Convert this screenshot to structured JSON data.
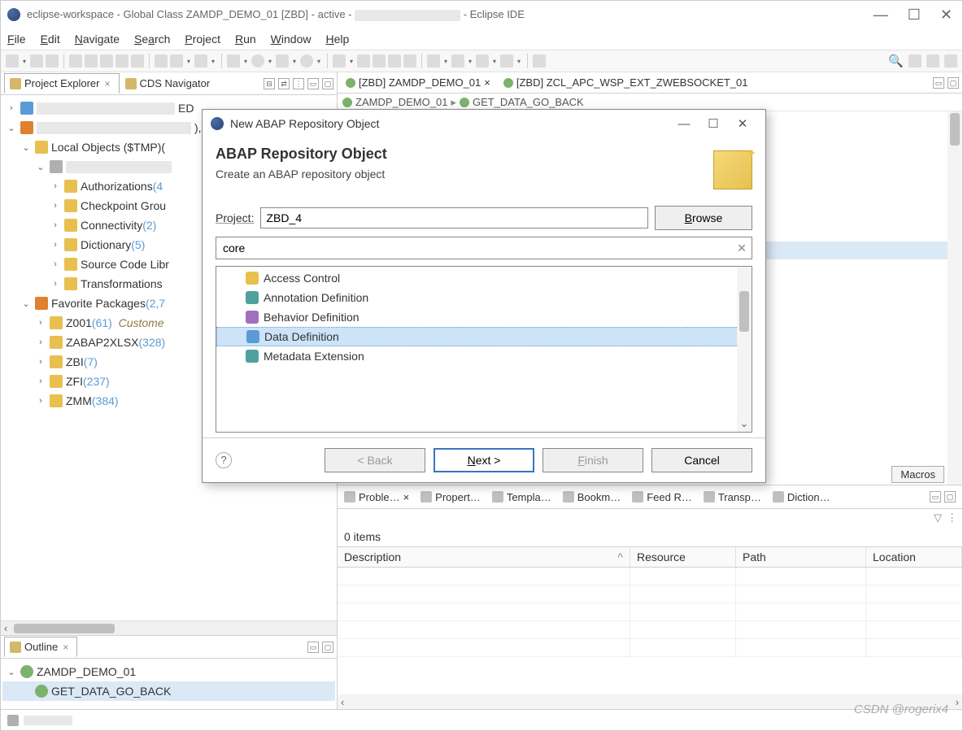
{
  "window": {
    "title_prefix": "eclipse-workspace - Global Class ZAMDP_DEMO_01 [ZBD]  - active - ",
    "title_suffix": " - Eclipse IDE"
  },
  "menubar": [
    "File",
    "Edit",
    "Navigate",
    "Search",
    "Project",
    "Run",
    "Window",
    "Help"
  ],
  "left": {
    "tabs": {
      "explorer": "Project Explorer",
      "cds": "CDS Navigator"
    },
    "tree": {
      "local": "Local Objects ($TMP)",
      "auth": "Authorizations",
      "auth_cnt": "(4",
      "chk": "Checkpoint Grou",
      "conn": "Connectivity",
      "conn_cnt": "(2)",
      "dict": "Dictionary",
      "dict_cnt": "(5)",
      "src": "Source Code Libr",
      "trans": "Transformations",
      "fav": "Favorite Packages",
      "fav_cnt": "(2,7",
      "z001": "Z001",
      "z001_cnt": "(61)",
      "z001_note": "Custome",
      "zabap": "ZABAP2XLSX",
      "zabap_cnt": "(328)",
      "zbi": "ZBI",
      "zbi_cnt": "(7)",
      "zfi": "ZFI",
      "zfi_cnt": "(237)",
      "zmm": "ZMM",
      "zmm_cnt": "(384)"
    },
    "outline": {
      "tab": "Outline",
      "root": "ZAMDP_DEMO_01",
      "child": "GET_DATA_GO_BACK"
    }
  },
  "editor": {
    "tab1": "[ZBD] ZAMDP_DEMO_01",
    "tab2": "[ZBD] ZCL_APC_WSP_EXT_ZWEBSOCKET_01",
    "bc1": "ZAMDP_DEMO_01",
    "bc2": "GET_DATA_GO_BACK",
    "macros_btn": "Macros"
  },
  "bottom": {
    "tabs": [
      "Proble…",
      "Propert…",
      "Templa…",
      "Bookm…",
      "Feed R…",
      "Transp…",
      "Diction…"
    ],
    "items_label": "0 items",
    "cols": {
      "desc": "Description",
      "res": "Resource",
      "path": "Path",
      "loc": "Location"
    }
  },
  "dialog": {
    "win_title": "New ABAP Repository Object",
    "heading": "ABAP Repository Object",
    "sub": "Create an ABAP repository object",
    "project_label": "Project:",
    "project_value": "ZBD_4",
    "browse": "Browse",
    "filter": "core",
    "items": [
      "Access Control",
      "Annotation Definition",
      "Behavior Definition",
      "Data Definition",
      "Metadata Extension"
    ],
    "selected": "Data Definition",
    "back": "< Back",
    "next": "Next >",
    "finish": "Finish",
    "cancel": "Cancel"
  },
  "watermark": "CSDN @rogerix4"
}
